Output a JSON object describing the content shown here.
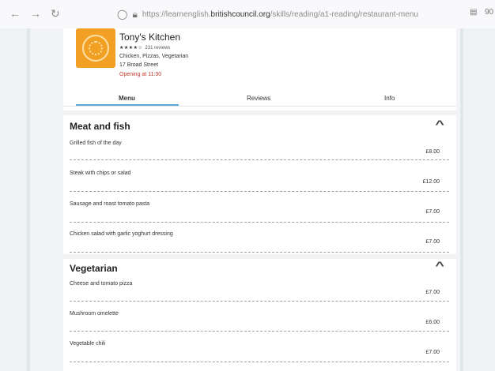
{
  "browser": {
    "url_prefix": "https://learnenglish.",
    "url_domain": "britishcouncil.org",
    "url_path": "/skills/reading/a1-reading/restaurant-menu",
    "right_text": "90"
  },
  "restaurant": {
    "name": "Tony's Kitchen",
    "stars": "★★★★☆",
    "reviews": "231 reviews",
    "cuisine": "Chicken, Pizzas, Vegetarian",
    "address": "17 Broad Street",
    "opening": "Opening at 11:30"
  },
  "tabs": [
    {
      "label": "Menu",
      "active": true
    },
    {
      "label": "Reviews",
      "active": false
    },
    {
      "label": "Info",
      "active": false
    }
  ],
  "sections": [
    {
      "title": "Meat and fish",
      "items": [
        {
          "name": "Grilled fish of the day",
          "price": "£8.00"
        },
        {
          "name": "Steak with chips or salad",
          "price": "£12.00"
        },
        {
          "name": "Sausage and roast tomato pasta",
          "price": "£7.00"
        },
        {
          "name": "Chicken salad with garlic yoghurt dressing",
          "price": "£7.00"
        }
      ]
    },
    {
      "title": "Vegetarian",
      "items": [
        {
          "name": "Cheese and tomato pizza",
          "price": "£7.00"
        },
        {
          "name": "Mushroom omelette",
          "price": "£6.00"
        },
        {
          "name": "Vegetable chili",
          "price": "£7.00"
        }
      ]
    }
  ],
  "icons": {
    "back": "arrow-left-icon",
    "forward": "arrow-right-icon",
    "reload": "reload-icon",
    "shield": "shield-icon",
    "lock": "lock-icon",
    "reader": "reader-view-icon",
    "collapse": "chevron-up-icon"
  },
  "colors": {
    "logo": "#f2a023",
    "opening": "#c0392b",
    "tab_active": "#5fa7d8"
  }
}
